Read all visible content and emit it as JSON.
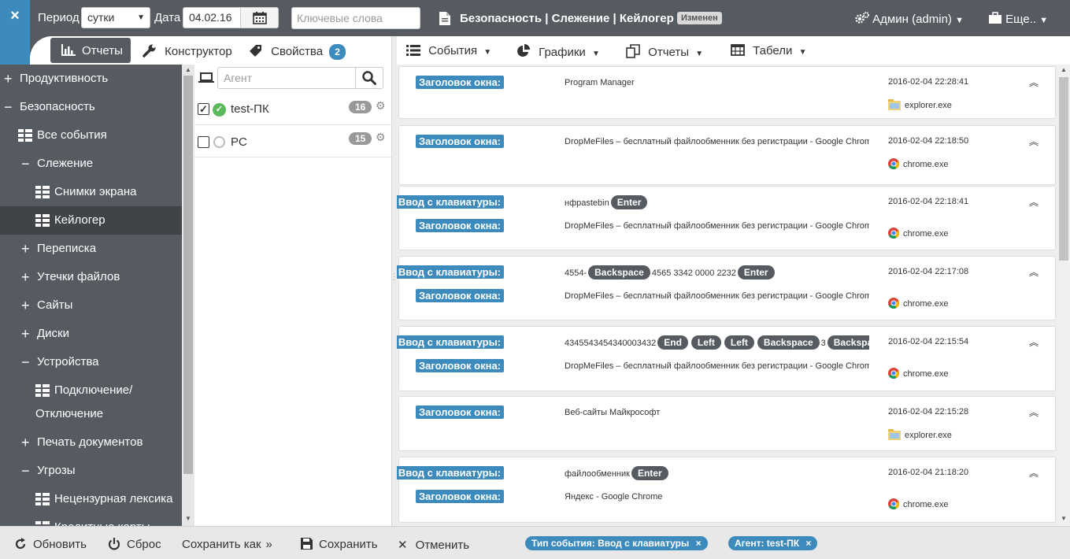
{
  "topbar": {
    "close_label": "×",
    "period_label": "Период",
    "period_value": "сутки",
    "date_label": "Дата",
    "date_value": "04.02.16",
    "keywords_placeholder": "Ключевые слова",
    "page_title": "Безопасность | Слежение | Кейлогер",
    "changed_badge": "Изменен",
    "admin_label": "Админ (admin)",
    "more_label": "Еще.."
  },
  "tabs": {
    "reports": "Отчеты",
    "constructor": "Конструктор",
    "properties": "Свойства",
    "properties_count": "2"
  },
  "sidebar": {
    "items": [
      {
        "label": "Продуктивность",
        "sign": "+"
      },
      {
        "label": "Безопасность",
        "sign": "−"
      },
      {
        "label": "Все события"
      },
      {
        "label": "Слежение",
        "sign": "−"
      },
      {
        "label": "Снимки экрана"
      },
      {
        "label": "Кейлогер"
      },
      {
        "label": "Переписка",
        "sign": "+"
      },
      {
        "label": "Утечки файлов",
        "sign": "+"
      },
      {
        "label": "Сайты",
        "sign": "+"
      },
      {
        "label": "Диски",
        "sign": "+"
      },
      {
        "label": "Устройства",
        "sign": "−"
      },
      {
        "label": "Подключение/"
      },
      {
        "label": "Отключение"
      },
      {
        "label": "Печать документов",
        "sign": "+"
      },
      {
        "label": "Угрозы",
        "sign": "−"
      },
      {
        "label": "Нецензурная лексика"
      },
      {
        "label": "Кредитные карты"
      }
    ]
  },
  "agents": {
    "search_placeholder": "Агент",
    "list": [
      {
        "name": "test-ПК",
        "count": "16",
        "checked": true
      },
      {
        "name": "PC",
        "count": "15",
        "checked": false
      }
    ]
  },
  "right_tabs": {
    "events": "События",
    "charts": "Графики",
    "reports": "Отчеты",
    "tables": "Табели"
  },
  "labels": {
    "window_title": "Заголовок окна:",
    "keyboard_input": "Ввод с клавиатуры:"
  },
  "events": [
    {
      "window": "Program Manager",
      "time": "2016-02-04 22:28:41",
      "process": "explorer.exe"
    },
    {
      "window": "DropMeFiles – бесплатный файлообменник без регистрации - Google Chrome",
      "time": "2016-02-04 22:18:50",
      "process": "chrome.exe"
    },
    {
      "keys_text": "нфpastebin",
      "keys": [
        "Enter"
      ],
      "window": "DropMeFiles – бесплатный файлообменник без регистрации - Google Chrome",
      "time": "2016-02-04 22:18:41",
      "process": "chrome.exe"
    },
    {
      "keys_text": "4554-",
      "keys_mid": "Backspace",
      "keys_text2": "4565 3342 0000 2232",
      "keys_end": "Enter",
      "window": "DropMeFiles – бесплатный файлообменник без регистрации - Google Chrome",
      "time": "2016-02-04 22:17:08",
      "process": "chrome.exe"
    },
    {
      "keys_text": "4345543454340003432",
      "key_list": [
        "End",
        "Left",
        "Left",
        "Backspace"
      ],
      "keys_text2": "3",
      "key_last": "Backspace",
      "window": "DropMeFiles – бесплатный файлообменник без регистрации - Google Chrome",
      "time": "2016-02-04 22:15:54",
      "process": "chrome.exe"
    },
    {
      "window": "Веб-сайты Майкрософт",
      "time": "2016-02-04 22:15:28",
      "process": "explorer.exe"
    },
    {
      "keys_text": "файлообменник",
      "keys": [
        "Enter"
      ],
      "window": "Яндекс - Google Chrome",
      "time": "2016-02-04 21:18:20",
      "process": "chrome.exe"
    }
  ],
  "bottom": {
    "refresh": "Обновить",
    "reset": "Сброс",
    "save_as": "Сохранить как",
    "save": "Сохранить",
    "cancel": "Отменить",
    "filter1": "Тип события: Ввод с клавиатуры",
    "filter2": "Агент: test-ПК",
    "filter_remove": "×"
  },
  "colors": {
    "dark": "#555b61",
    "accent": "#3d8bbd",
    "active_nav": "#404448"
  },
  "icons": {
    "calendar": "calendar-icon",
    "document": "document-icon",
    "gears": "gears-icon",
    "briefcase": "briefcase-icon",
    "chart": "bar-chart-icon",
    "wrench": "wrench-icon",
    "tag": "tag-icon",
    "laptop": "laptop-icon",
    "search": "search-icon",
    "list": "list-icon",
    "pie": "pie-chart-icon",
    "copy": "reports-icon",
    "table": "table-icon",
    "refresh": "refresh-icon",
    "power": "power-icon",
    "chevron_double": "chevrons-right-icon",
    "floppy": "save-icon",
    "close": "close-icon"
  }
}
